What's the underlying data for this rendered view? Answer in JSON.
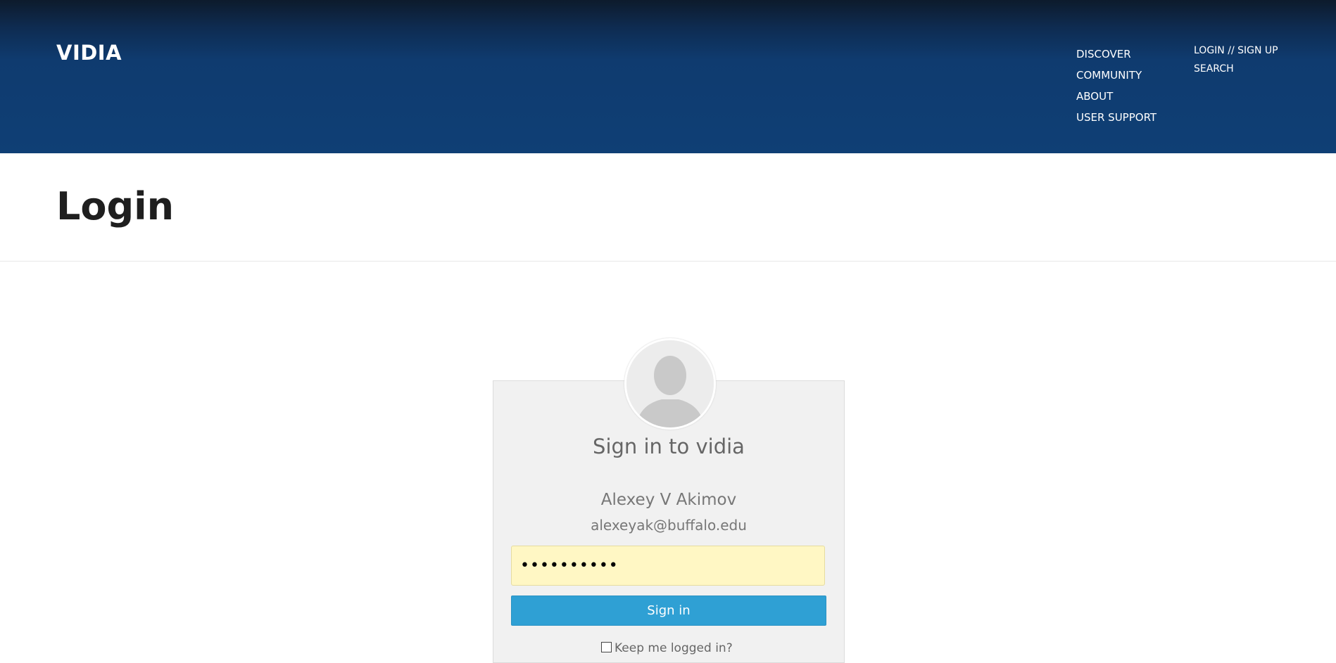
{
  "header": {
    "logo": "VIDIA",
    "nav_main": [
      "DISCOVER",
      "COMMUNITY",
      "ABOUT",
      "USER SUPPORT"
    ],
    "nav_side": [
      "LOGIN // SIGN UP",
      "SEARCH"
    ]
  },
  "page": {
    "title": "Login"
  },
  "login_card": {
    "avatar_icon": "user-silhouette-icon",
    "title": "Sign in to vidia",
    "user_name": "Alexey V Akimov",
    "user_email": "alexeyak@buffalo.edu",
    "password_value": "••••••••••",
    "signin_label": "Sign in",
    "keep_logged_in_label": "Keep me logged in?"
  },
  "colors": {
    "header_bg": "#0f3f75",
    "button_bg": "#2fa0d4",
    "autofill_bg": "#fff7c4"
  }
}
